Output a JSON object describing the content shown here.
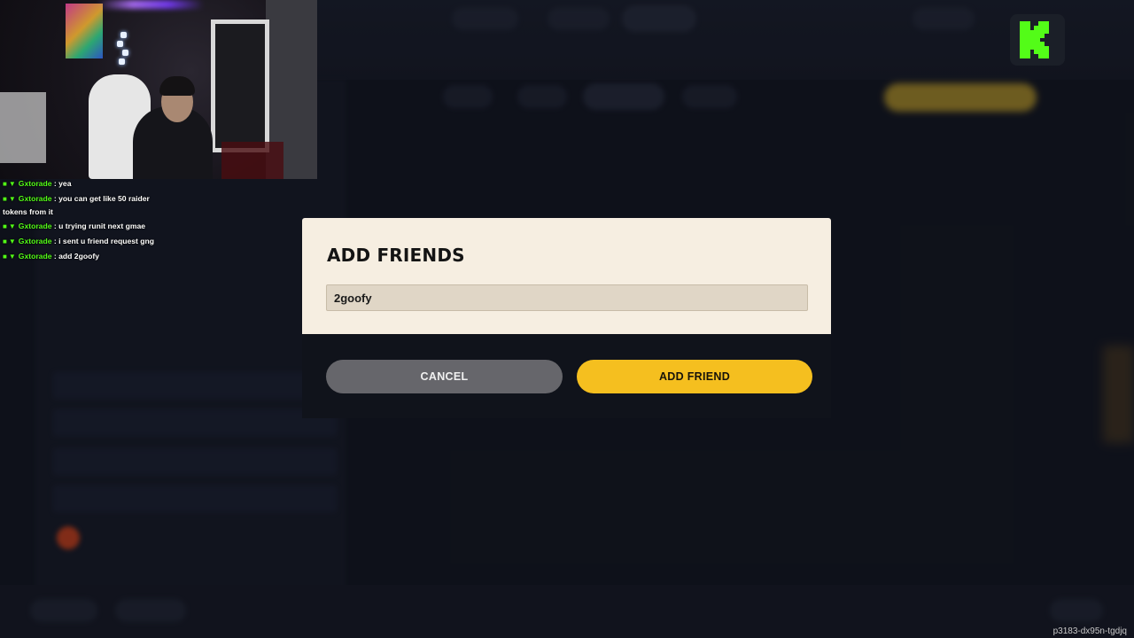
{
  "webcam": {},
  "chat": {
    "messages": [
      {
        "user": "Gxtorade",
        "text": ": yea"
      },
      {
        "user": "Gxtorade",
        "text": ": you can get like 50 raider tokens from it"
      },
      {
        "user": "Gxtorade",
        "text": ": u trying runit next gmae"
      },
      {
        "user": "Gxtorade",
        "text": ": i sent u friend request gng"
      },
      {
        "user": "Gxtorade",
        "text": ": add 2goofy"
      }
    ]
  },
  "modal": {
    "title": "ADD FRIENDS",
    "input_value": "2goofy",
    "input_placeholder": "",
    "cancel_label": "CANCEL",
    "add_label": "ADD FRIEND"
  },
  "brand": {
    "kick_green": "#53fc18",
    "accent_yellow": "#f5bf1f"
  },
  "watermark": "p3183-dx95n-tgdjq"
}
